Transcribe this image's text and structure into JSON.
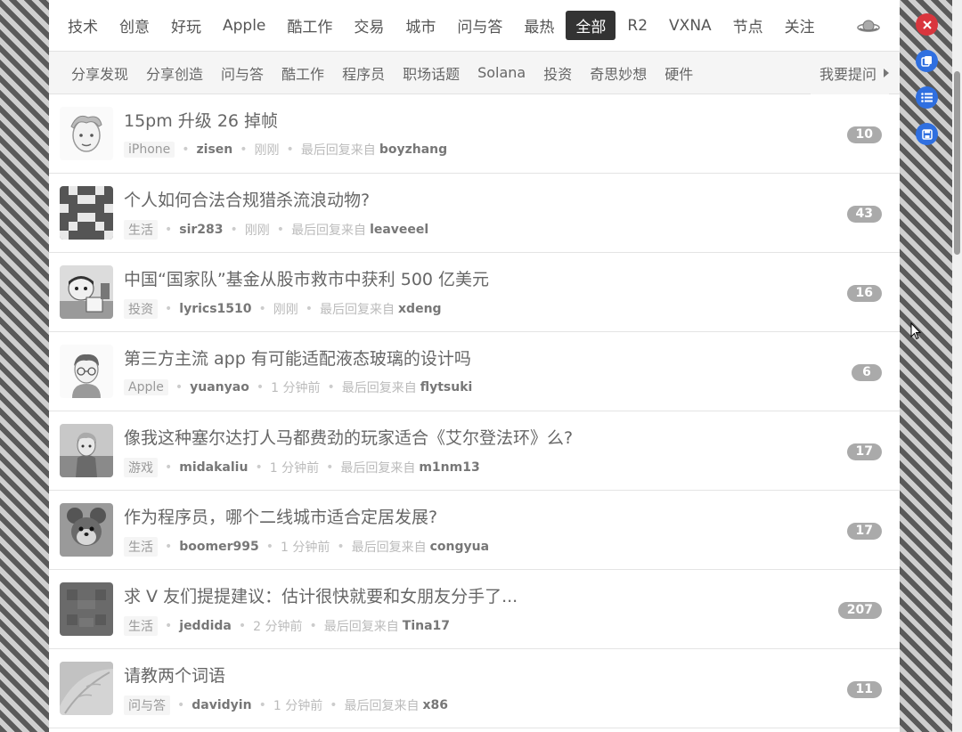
{
  "tabs": [
    {
      "label": "技术",
      "active": false
    },
    {
      "label": "创意",
      "active": false
    },
    {
      "label": "好玩",
      "active": false
    },
    {
      "label": "Apple",
      "active": false
    },
    {
      "label": "酷工作",
      "active": false
    },
    {
      "label": "交易",
      "active": false
    },
    {
      "label": "城市",
      "active": false
    },
    {
      "label": "问与答",
      "active": false
    },
    {
      "label": "最热",
      "active": false
    },
    {
      "label": "全部",
      "active": true
    },
    {
      "label": "R2",
      "active": false
    },
    {
      "label": "VXNA",
      "active": false
    },
    {
      "label": "节点",
      "active": false
    },
    {
      "label": "关注",
      "active": false
    }
  ],
  "nodes": [
    "分享发现",
    "分享创造",
    "问与答",
    "酷工作",
    "程序员",
    "职场话题",
    "Solana",
    "投资",
    "奇思妙想",
    "硬件"
  ],
  "ask_link": "我要提问",
  "last_reply_label": "最后回复来自",
  "topics": [
    {
      "title": "15pm 升级 26 掉帧",
      "node": "iPhone",
      "author": "zisen",
      "time": "刚刚",
      "last_reply": "boyzhang",
      "count": "10"
    },
    {
      "title": "个人如何合法合规猎杀流浪动物?",
      "node": "生活",
      "author": "sir283",
      "time": "刚刚",
      "last_reply": "leaveeel",
      "count": "43"
    },
    {
      "title": "中国“国家队”基金从股市救市中获利 500 亿美元",
      "node": "投资",
      "author": "lyrics1510",
      "time": "刚刚",
      "last_reply": "xdeng",
      "count": "16"
    },
    {
      "title": "第三方主流 app 有可能适配液态玻璃的设计吗",
      "node": "Apple",
      "author": "yuanyao",
      "time": "1 分钟前",
      "last_reply": "flytsuki",
      "count": "6"
    },
    {
      "title": "像我这种塞尔达打人马都费劲的玩家适合《艾尔登法环》么?",
      "node": "游戏",
      "author": "midakaliu",
      "time": "1 分钟前",
      "last_reply": "m1nm13",
      "count": "17"
    },
    {
      "title": "作为程序员，哪个二线城市适合定居发展?",
      "node": "生活",
      "author": "boomer995",
      "time": "1 分钟前",
      "last_reply": "congyua",
      "count": "17"
    },
    {
      "title": "求 V 友们提提建议：估计很快就要和女朋友分手了...",
      "node": "生活",
      "author": "jeddida",
      "time": "2 分钟前",
      "last_reply": "Tina17",
      "count": "207"
    },
    {
      "title": "请教两个词语",
      "node": "问与答",
      "author": "davidyin",
      "time": "1 分钟前",
      "last_reply": "x86",
      "count": "11"
    }
  ],
  "colors": {
    "active_tab_bg": "#333333",
    "count_badge_bg": "#aaaaaa",
    "close_button": "#d9363e",
    "action_button": "#2f6fe0"
  },
  "floating_buttons": [
    {
      "name": "close-button",
      "icon": "close-icon"
    },
    {
      "name": "copy-button",
      "icon": "copy-icon"
    },
    {
      "name": "list-button",
      "icon": "list-icon"
    },
    {
      "name": "save-button",
      "icon": "save-icon"
    }
  ]
}
